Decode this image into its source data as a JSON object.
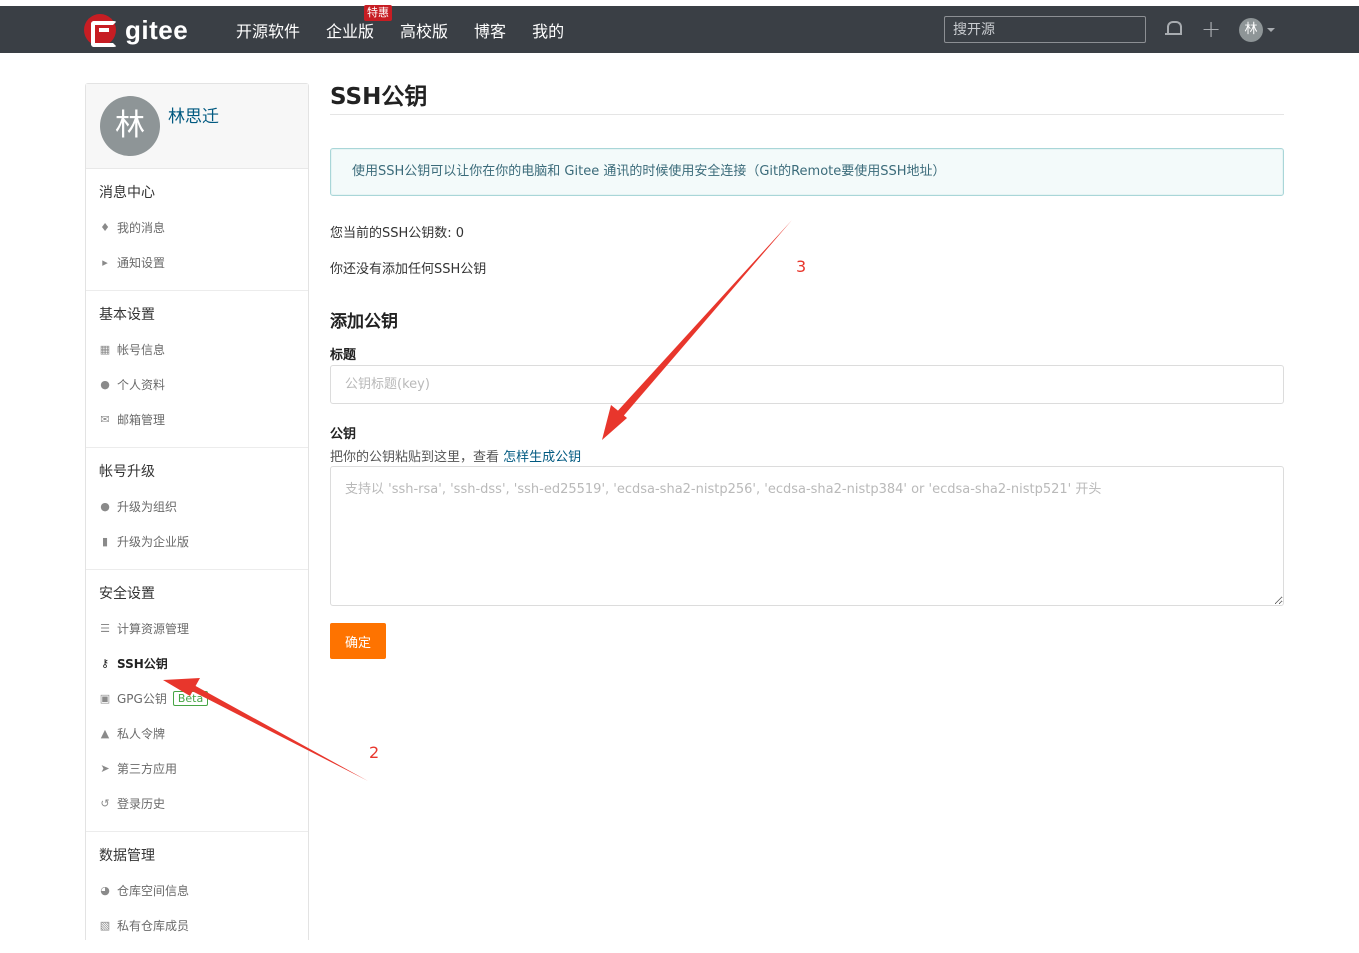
{
  "navbar": {
    "logo_text": "gitee",
    "menu": [
      {
        "label": "开源软件"
      },
      {
        "label": "企业版",
        "badge": "特惠"
      },
      {
        "label": "高校版"
      },
      {
        "label": "博客"
      },
      {
        "label": "我的"
      }
    ],
    "search_placeholder": "搜开源",
    "avatar_text": "林",
    "icons": [
      "bell-icon",
      "plus-icon",
      "chevron-down-icon"
    ]
  },
  "sidebar": {
    "user": {
      "avatar_text": "林",
      "name": "林思迁"
    },
    "groups": [
      {
        "title": "消息中心",
        "items": [
          {
            "label": "我的消息",
            "icon": "bell-icon"
          },
          {
            "label": "通知设置",
            "icon": "volume-icon"
          }
        ]
      },
      {
        "title": "基本设置",
        "items": [
          {
            "label": "帐号信息",
            "icon": "id-card-icon"
          },
          {
            "label": "个人资料",
            "icon": "user-icon"
          },
          {
            "label": "邮箱管理",
            "icon": "envelope-icon"
          }
        ]
      },
      {
        "title": "帐号升级",
        "items": [
          {
            "label": "升级为组织",
            "icon": "group-icon"
          },
          {
            "label": "升级为企业版",
            "icon": "building-icon"
          }
        ]
      },
      {
        "title": "安全设置",
        "items": [
          {
            "label": "计算资源管理",
            "icon": "server-icon"
          },
          {
            "label": "SSH公钥",
            "icon": "key-icon",
            "active": true
          },
          {
            "label": "GPG公钥",
            "icon": "lock-icon",
            "badge": "Beta"
          },
          {
            "label": "私人令牌",
            "icon": "token-icon"
          },
          {
            "label": "第三方应用",
            "icon": "rocket-icon"
          },
          {
            "label": "登录历史",
            "icon": "history-icon"
          }
        ]
      },
      {
        "title": "数据管理",
        "items": [
          {
            "label": "仓库空间信息",
            "icon": "pie-chart-icon"
          },
          {
            "label": "私有仓库成员",
            "icon": "repo-icon"
          }
        ]
      }
    ]
  },
  "main": {
    "title": "SSH公钥",
    "info": "使用SSH公钥可以让你在你的电脑和 Gitee 通讯的时候使用安全连接（Git的Remote要使用SSH地址）",
    "key_count": "您当前的SSH公钥数: 0",
    "no_keys": "你还没有添加任何SSH公钥",
    "add_title": "添加公钥",
    "title_label": "标题",
    "title_placeholder": "公钥标题(key)",
    "key_label": "公钥",
    "key_hint": "把你的公钥粘贴到这里，查看 ",
    "key_hint_link": "怎样生成公钥",
    "key_placeholder": "支持以 'ssh-rsa', 'ssh-dss', 'ssh-ed25519', 'ecdsa-sha2-nistp256', 'ecdsa-sha2-nistp384' or 'ecdsa-sha2-nistp521' 开头",
    "submit_label": "确定"
  },
  "annotations": {
    "colors": {
      "arrow": "#e8362c"
    },
    "labels": [
      "2",
      "3"
    ]
  }
}
